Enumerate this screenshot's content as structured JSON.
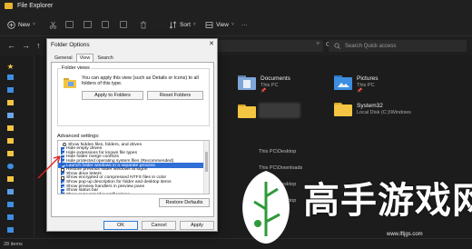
{
  "window": {
    "title": "File Explorer"
  },
  "toolbar": {
    "new_label": "New",
    "sort_label": "Sort",
    "view_label": "View",
    "more_label": "···"
  },
  "address": {
    "search_placeholder": "Search Quick access",
    "expand_chevron": "˅"
  },
  "nav": {
    "back": "←",
    "forward": "→",
    "up": "↑",
    "refresh": "⟳"
  },
  "content": {
    "quick_access": [
      {
        "name": "Documents",
        "sub": "This PC",
        "pin": "📌"
      },
      {
        "name": "Pictures",
        "sub": "This PC",
        "pin": "📌"
      },
      {
        "name": "System32",
        "sub": "Local Disk (C:)\\Windows",
        "pin": ""
      }
    ],
    "recent_paths": [
      "This PC\\Desktop",
      "This PC\\Downloads",
      "This PC\\Desktop",
      "This PC\\Desktop"
    ]
  },
  "status": {
    "items": "28 items"
  },
  "dialog": {
    "title": "Folder Options",
    "close": "✕",
    "tabs": [
      "General",
      "View",
      "Search"
    ],
    "active_tab": "View",
    "folder_views": {
      "label": "Folder views",
      "description": "You can apply this view (such as Details or Icons) to all folders of this type.",
      "apply_button": "Apply to Folders",
      "reset_button": "Reset Folders"
    },
    "advanced": {
      "label": "Advanced settings:",
      "items": [
        {
          "text": "Show hidden files, folders, and drives",
          "type": "radio",
          "checked": false,
          "indent": true
        },
        {
          "text": "Hide empty drives",
          "type": "check",
          "checked": true,
          "indent": false
        },
        {
          "text": "Hide extensions for known file types",
          "type": "check",
          "checked": true,
          "indent": false
        },
        {
          "text": "Hide folder merge conflicts",
          "type": "check",
          "checked": true,
          "indent": false
        },
        {
          "text": "Hide protected operating system files (Recommended)",
          "type": "check",
          "checked": true,
          "indent": false
        },
        {
          "text": "Launch folder windows in a separate process",
          "type": "check",
          "checked": true,
          "indent": false,
          "selected": true
        },
        {
          "text": "Restore previous folder windows at logon",
          "type": "check",
          "checked": false,
          "indent": false
        },
        {
          "text": "Show drive letters",
          "type": "check",
          "checked": true,
          "indent": false
        },
        {
          "text": "Show encrypted or compressed NTFS files in color",
          "type": "check",
          "checked": false,
          "indent": false
        },
        {
          "text": "Show pop-up description for folder and desktop items",
          "type": "check",
          "checked": true,
          "indent": false
        },
        {
          "text": "Show preview handlers in preview pane",
          "type": "check",
          "checked": true,
          "indent": false
        },
        {
          "text": "Show status bar",
          "type": "check",
          "checked": true,
          "indent": false
        },
        {
          "text": "Show sync provider notifications",
          "type": "check",
          "checked": true,
          "indent": false
        }
      ]
    },
    "restore_defaults": "Restore Defaults",
    "ok": "OK",
    "cancel": "Cancel",
    "apply": "Apply"
  },
  "watermark": {
    "chinese": "高手游戏网",
    "url": "www.lftjgs.com"
  },
  "colors": {
    "accent": "#2f6fd6",
    "folder": "#f4c542",
    "annotation": "#e02020"
  }
}
